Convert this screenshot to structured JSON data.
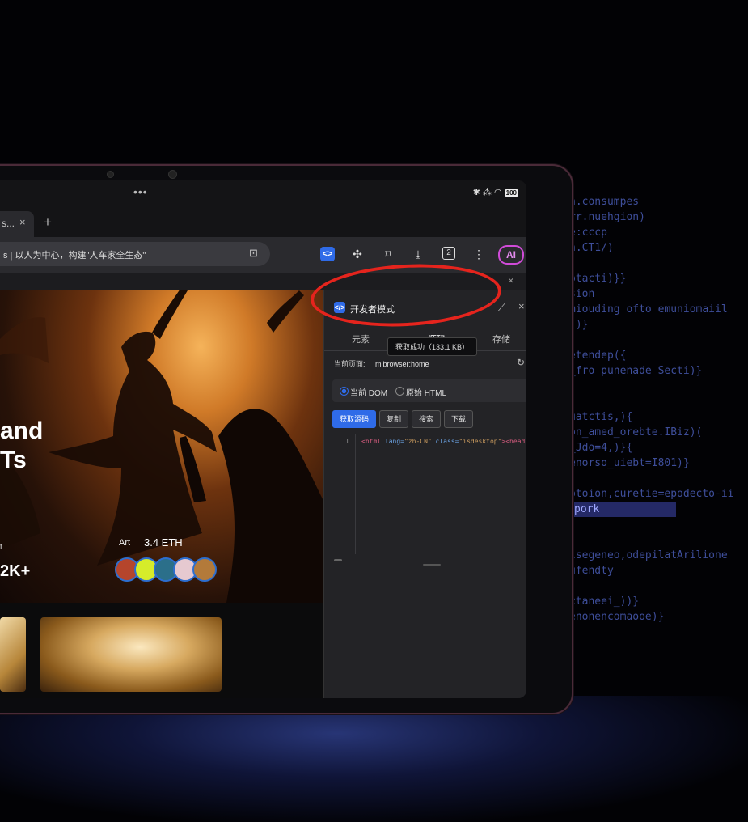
{
  "background": {
    "code_lines": [
      "n.consumpes",
      "rr.nuehgion)",
      "e:cccp",
      "n.CT1/)",
      "",
      "otacti)}}",
      "sion",
      "miouding ofto emuniomaiil",
      "))}",
      "",
      "etendep({",
      "_fro punenade Secti)}",
      "",
      "",
      "uatctis,){",
      "on_amed_orebte.IBiz)(",
      "_Jdo=4,)}{",
      "enorso_uiebt=I801)}",
      "",
      "otoion,curetie=epodecto-ii",
      "pork",
      "",
      "",
      "lsegeneo,odepilatArilione",
      "ufendty",
      "",
      "ctaneei_))}",
      "enonencomaooe)}",
      "",
      "",
      "",
      ""
    ],
    "highlight_line": "pork",
    "accent_color": "#e5241d"
  },
  "statusbar": {
    "dots": "•••",
    "icons": "✱ ⁂ ◠",
    "battery": "100"
  },
  "tabbar": {
    "tab_title": "s...",
    "close": "×",
    "new_tab": "+"
  },
  "toolbar": {
    "url_text": "s | 以人为中心，构建\"人车家全生态\"",
    "ai_label": "AI",
    "tab_count": "2"
  },
  "webpage": {
    "hero_title_line1": "and",
    "hero_title_line2": "Ts",
    "small_label": "t",
    "count": "2K+",
    "art_label": "Art",
    "eth_value": "3.4 ETH",
    "avatar_colors": [
      "#b5452c",
      "#d6ec2a",
      "#2b6f8a",
      "#e6c9d0",
      "#b37a3a"
    ]
  },
  "devpanel": {
    "title": "开发者模式",
    "tabs": [
      "元素",
      "源码",
      "存储"
    ],
    "tooltip": "获取成功（133.1 KB）",
    "current_page_label": "当前页面:",
    "current_page_value": "mibrowser:home",
    "radio_dom": "当前 DOM",
    "radio_html": "原始 HTML",
    "buttons": {
      "fetch": "获取源码",
      "copy": "复制",
      "search": "搜索",
      "download": "下载"
    },
    "code": {
      "line_number": "1",
      "tag_open": "<html ",
      "attr1": "lang=",
      "val1": "\"zh-CN\" ",
      "attr2": "class=",
      "val2": "\"isdesktop\"",
      "tail": "><head"
    }
  }
}
